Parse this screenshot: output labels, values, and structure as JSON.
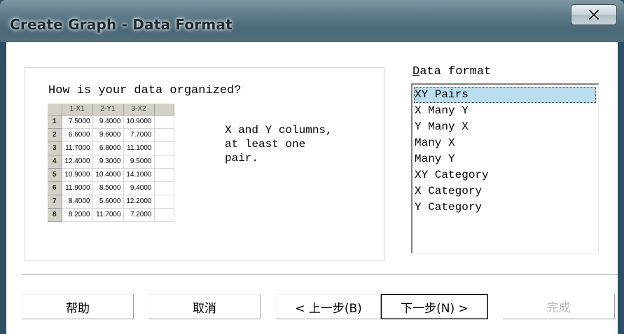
{
  "window": {
    "title": "Create Graph - Data Format",
    "close_icon": "close-icon"
  },
  "preview": {
    "question": "How is your data organized?",
    "description_lines": [
      "X and Y columns,",
      "at least one",
      "pair."
    ],
    "columns": [
      "1-X1",
      "2-Y1",
      "3-X2"
    ],
    "rows": [
      {
        "row": "1",
        "cells": [
          "7.5000",
          "9.4000",
          "10.9000"
        ]
      },
      {
        "row": "2",
        "cells": [
          "6.6000",
          "9.6000",
          "7.7000"
        ]
      },
      {
        "row": "3",
        "cells": [
          "11.7000",
          "6.8000",
          "11.1000"
        ]
      },
      {
        "row": "4",
        "cells": [
          "12.4000",
          "9.3000",
          "9.5000"
        ]
      },
      {
        "row": "5",
        "cells": [
          "10.9000",
          "10.4000",
          "14.1000"
        ]
      },
      {
        "row": "6",
        "cells": [
          "11.9000",
          "8.5000",
          "9.4000"
        ]
      },
      {
        "row": "7",
        "cells": [
          "8.4000",
          "5.6000",
          "12.2000"
        ]
      },
      {
        "row": "8",
        "cells": [
          "8.2000",
          "11.7000",
          "7.2000"
        ]
      }
    ]
  },
  "data_format": {
    "label_mnemonic": "D",
    "label_rest": "ata format",
    "selected": "XY Pairs",
    "options": [
      "XY Pairs",
      "X Many Y",
      "Y Many X",
      "Many X",
      "Many Y",
      "XY Category",
      "X Category",
      "Y Category"
    ]
  },
  "buttons": {
    "help": "帮助",
    "cancel": "取消",
    "back": "< 上一步(B)",
    "next": "下一步(N) >",
    "finish": "完成"
  }
}
